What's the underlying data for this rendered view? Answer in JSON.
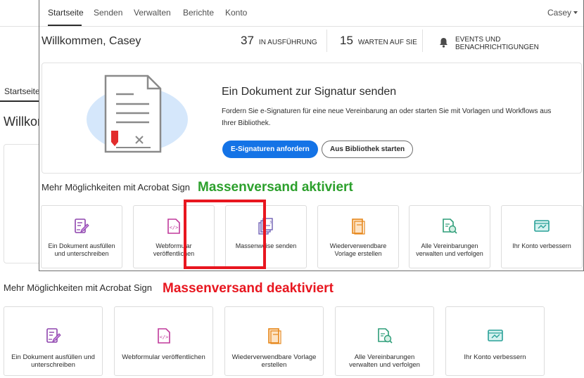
{
  "background": {
    "nav_active": "Startseite",
    "welcome": "Willkom",
    "more_heading": "Mehr Möglichkeiten mit Acrobat Sign",
    "annotation": "Massenversand deaktiviert",
    "tiles": [
      {
        "label": "Ein Dokument ausfüllen und unterschreiben",
        "icon": "fill-sign-icon"
      },
      {
        "label": "Webformular veröffentlichen",
        "icon": "web-form-icon"
      },
      {
        "label": "Wiederverwendbare Vorlage erstellen",
        "icon": "template-icon"
      },
      {
        "label": "Alle Vereinbarungen verwalten und verfolgen",
        "icon": "manage-agreements-icon"
      },
      {
        "label": "Ihr Konto verbessern",
        "icon": "upgrade-account-icon"
      }
    ]
  },
  "window": {
    "nav": {
      "tabs": [
        "Startseite",
        "Senden",
        "Verwalten",
        "Berichte",
        "Konto"
      ],
      "active": "Startseite",
      "user": "Casey"
    },
    "welcome": "Willkommen, Casey",
    "stats": [
      {
        "count": "37",
        "label": "IN AUSFÜHRUNG"
      },
      {
        "count": "15",
        "label": "WARTEN AUF SIE"
      }
    ],
    "notifications_label": "EVENTS UND BENACHRICHTIGUNGEN",
    "hero": {
      "title": "Ein Dokument zur Signatur senden",
      "description": "Fordern Sie e-Signaturen für eine neue Vereinbarung an oder starten Sie mit Vorlagen und Workflows aus Ihrer Bibliothek.",
      "primary_button": "E-Signaturen anfordern",
      "secondary_button": "Aus Bibliothek starten"
    },
    "more_heading": "Mehr Möglichkeiten mit Acrobat Sign",
    "annotation": "Massenversand aktiviert",
    "tiles": [
      {
        "label": "Ein Dokument ausfüllen und unterschreiben",
        "icon": "fill-sign-icon"
      },
      {
        "label": "Webformular veröffentlichen",
        "icon": "web-form-icon"
      },
      {
        "label": "Massenweise senden",
        "icon": "bulk-send-icon"
      },
      {
        "label": "Wiederverwendbare Vorlage erstellen",
        "icon": "template-icon"
      },
      {
        "label": "Alle Vereinbarungen verwalten und verfolgen",
        "icon": "manage-agreements-icon"
      },
      {
        "label": "Ihr Konto verbessern",
        "icon": "upgrade-account-icon"
      }
    ]
  },
  "colors": {
    "primary": "#1473e6",
    "annotation_red": "#e8161f",
    "annotation_green": "#2ca02c",
    "fill_sign": "#8e44ad",
    "web_form": "#c0399b",
    "bulk_send": "#6e5fb4",
    "template": "#e68619",
    "manage": "#2d9d78",
    "upgrade": "#2aa198"
  }
}
